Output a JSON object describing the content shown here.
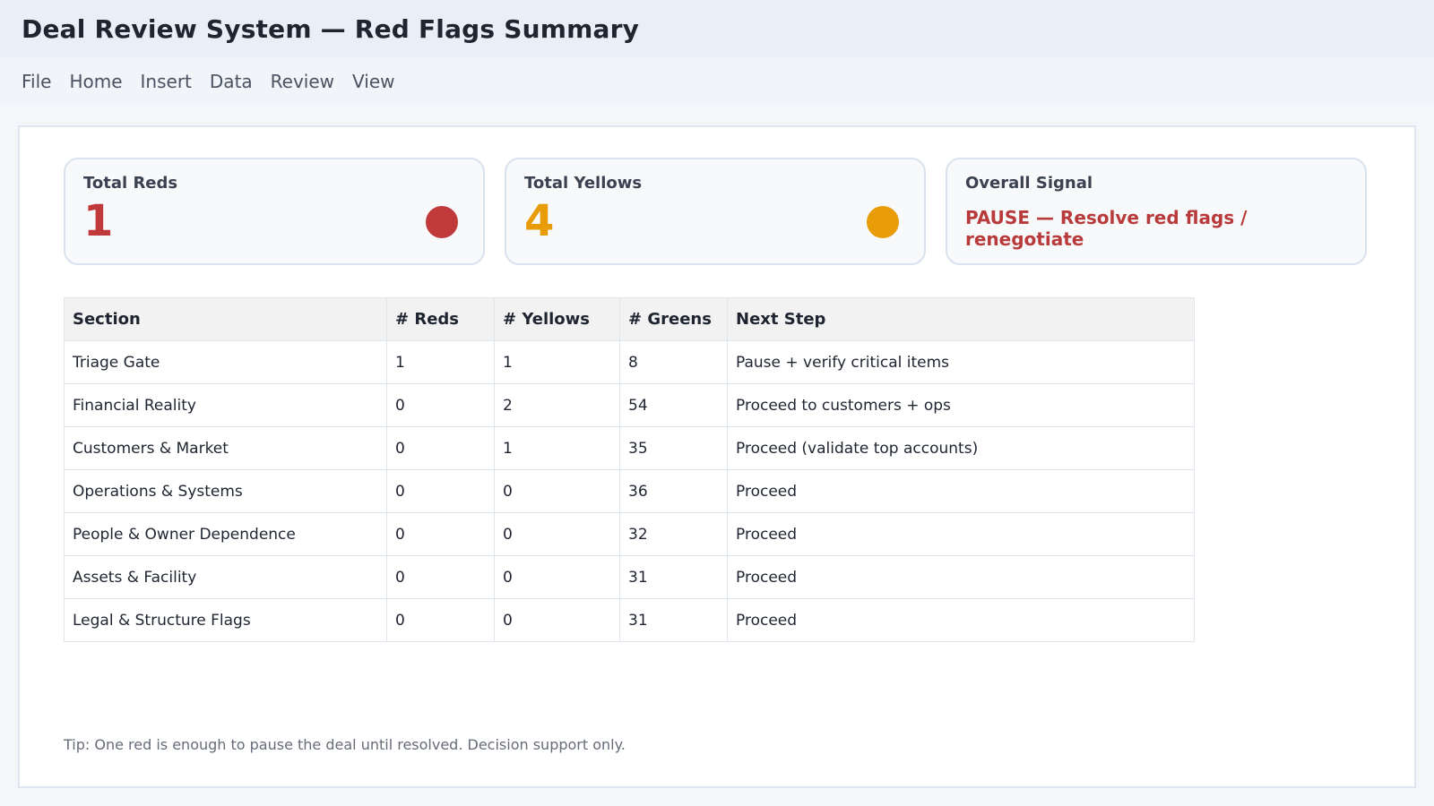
{
  "app": {
    "title": "Deal Review System — Red Flags Summary"
  },
  "menu": [
    "File",
    "Home",
    "Insert",
    "Data",
    "Review",
    "View"
  ],
  "colors": {
    "red": "#c0393b",
    "yellow": "#e79c08"
  },
  "cards": {
    "reds": {
      "label": "Total Reds",
      "value": "1",
      "indicator": "red-dot-icon"
    },
    "yellows": {
      "label": "Total Yellows",
      "value": "4",
      "indicator": "yellow-dot-icon"
    },
    "signal": {
      "label": "Overall Signal",
      "value": "PAUSE — Resolve red flags / renegotiate"
    }
  },
  "table": {
    "headers": [
      "Section",
      "# Reds",
      "# Yellows",
      "# Greens",
      "Next Step"
    ],
    "rows": [
      [
        "Triage Gate",
        "1",
        "1",
        "8",
        "Pause + verify critical items"
      ],
      [
        "Financial Reality",
        "0",
        "2",
        "54",
        "Proceed to customers + ops"
      ],
      [
        "Customers & Market",
        "0",
        "1",
        "35",
        "Proceed (validate top accounts)"
      ],
      [
        "Operations & Systems",
        "0",
        "0",
        "36",
        "Proceed"
      ],
      [
        "People & Owner Dependence",
        "0",
        "0",
        "32",
        "Proceed"
      ],
      [
        "Assets & Facility",
        "0",
        "0",
        "31",
        "Proceed"
      ],
      [
        "Legal & Structure Flags",
        "0",
        "0",
        "31",
        "Proceed"
      ]
    ]
  },
  "tip": "Tip: One red is enough to pause the deal until resolved. Decision support only."
}
